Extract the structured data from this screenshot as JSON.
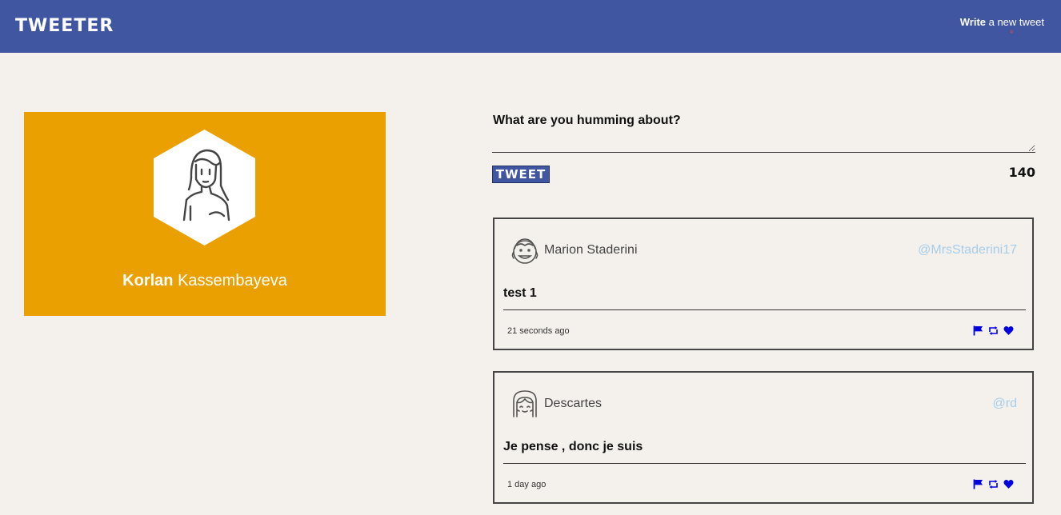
{
  "navbar": {
    "brand": "TWEETER",
    "compose_link_bold": "Write",
    "compose_link_rest": " a new tweet",
    "compose_link_chevron": "»"
  },
  "profile": {
    "first_name": "Korlan",
    "last_name": "Kassembayeva"
  },
  "compose": {
    "label": "What are you humming about?",
    "textarea_value": "",
    "button_label": "TWEET",
    "counter": "140"
  },
  "tweets": [
    {
      "name": "Marion Staderini",
      "handle": "@MrsStaderini17",
      "content": "test 1",
      "time": "21 seconds ago"
    },
    {
      "name": "Descartes",
      "handle": "@rd",
      "content": "Je pense , donc je suis",
      "time": "1 day ago"
    }
  ],
  "colors": {
    "navbar": "#4056a1",
    "profile_card": "#eba002",
    "page_background": "#f4f1ec",
    "handle": "#a6cdea",
    "action_icons": "#0000dd"
  },
  "icons": [
    "flag-icon",
    "retweet-icon",
    "heart-icon"
  ]
}
